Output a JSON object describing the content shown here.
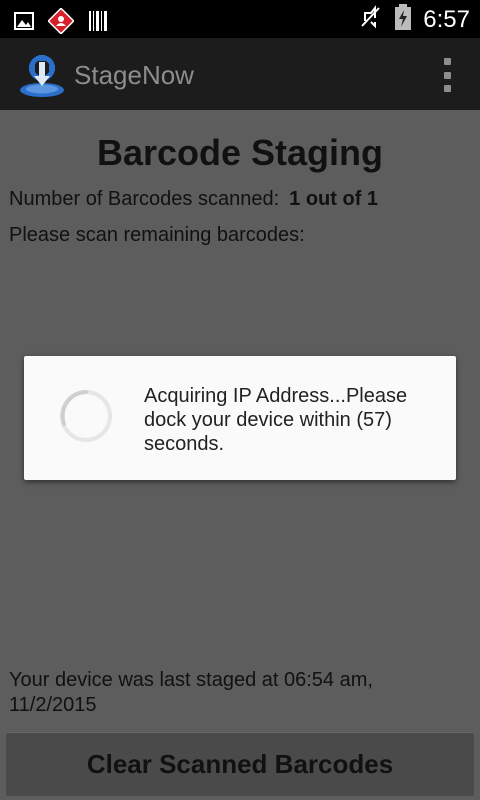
{
  "status_bar": {
    "time": "6:57",
    "icons": [
      "gallery-icon",
      "notification-app-icon",
      "barcode-icon",
      "mute-icon",
      "battery-charging-icon"
    ]
  },
  "action_bar": {
    "app_title": "StageNow",
    "logo_icon": "stagenow-logo-icon",
    "menu_icon": "overflow-menu-icon"
  },
  "main": {
    "page_title": "Barcode Staging",
    "scan_count_label": "Number of Barcodes scanned:",
    "scan_count_value": "1 out of 1",
    "scan_prompt": "Please scan remaining barcodes:",
    "last_staged": "Your device was last staged at 06:54 am, 11/2/2015",
    "clear_button_label": "Clear Scanned Barcodes"
  },
  "dialog": {
    "message": "Acquiring IP Address...Please dock your device within (57) seconds.",
    "spinner_icon": "loading-spinner-icon"
  },
  "colors": {
    "status_bar_bg": "#000000",
    "action_bar_bg": "#1c1c1c",
    "dimmed_content_bg": "#5d5d5d",
    "dialog_bg": "#fafafa",
    "logo_blue": "#2a6fc9"
  }
}
